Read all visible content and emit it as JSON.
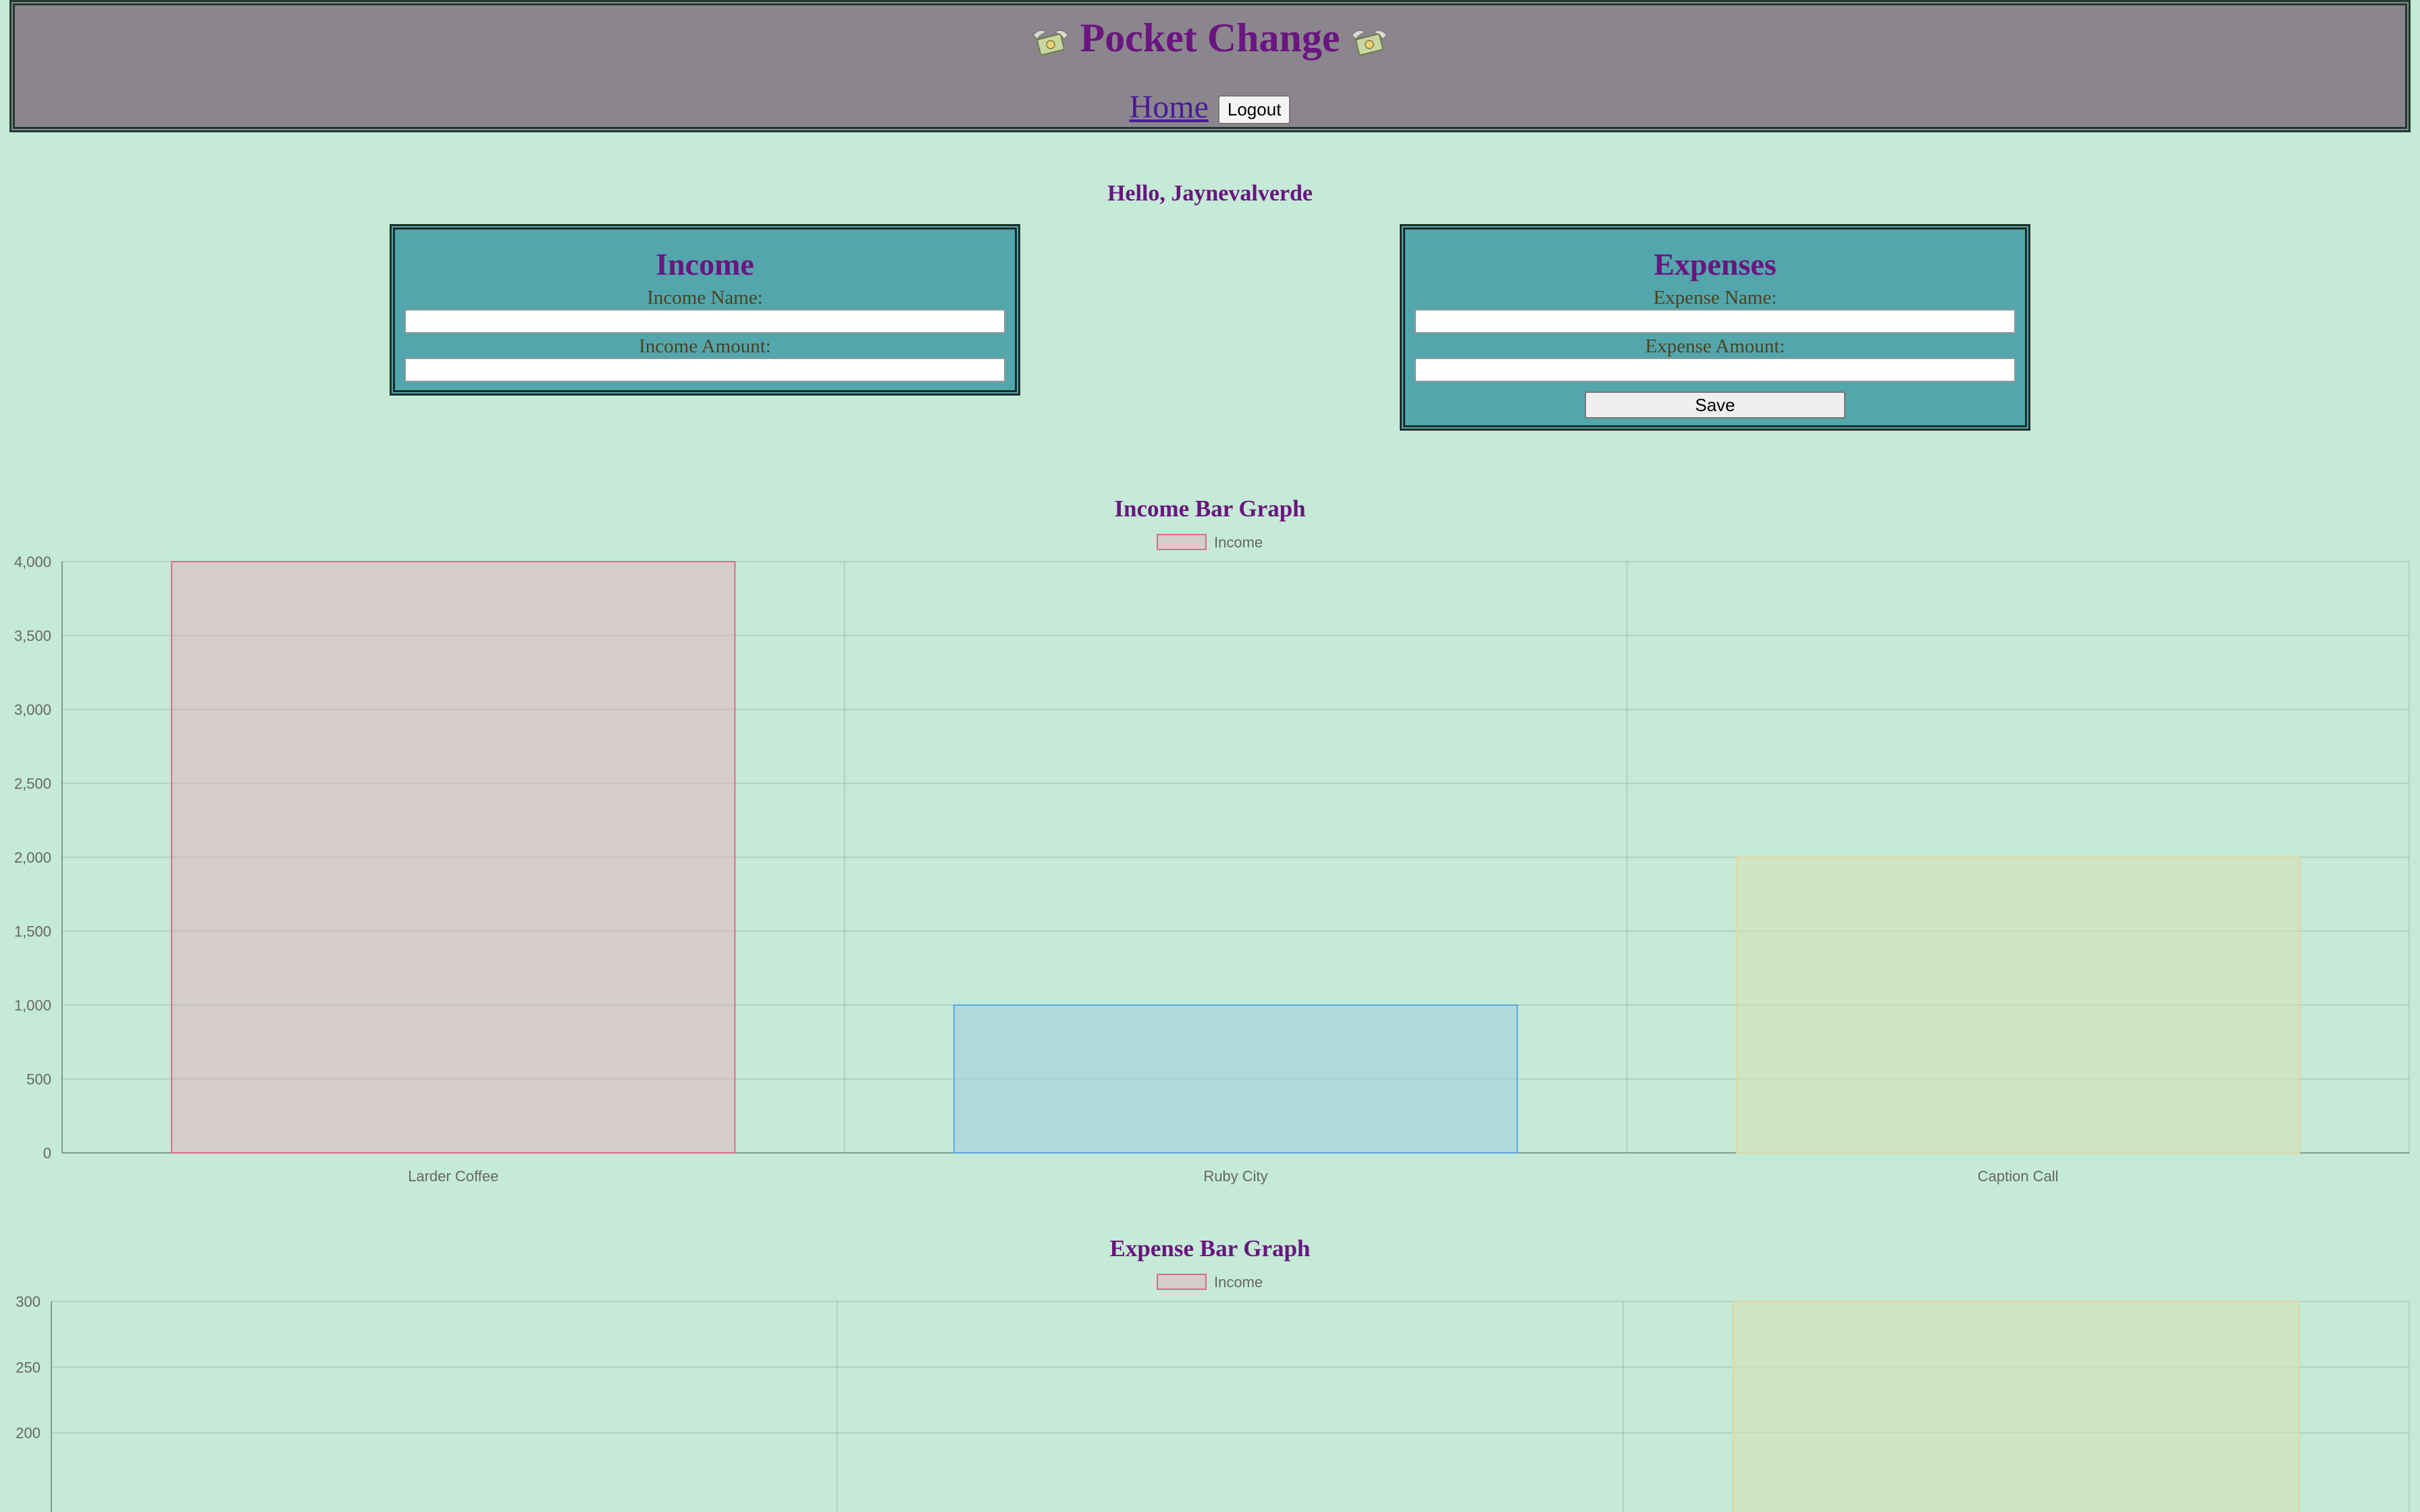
{
  "header": {
    "title": "Pocket Change",
    "left_icon": "money-with-wings-icon",
    "right_icon": "money-with-wings-icon"
  },
  "nav": {
    "home_label": "Home",
    "logout_label": "Logout"
  },
  "greeting": "Hello, Jaynevalverde",
  "income_panel": {
    "title": "Income",
    "name_label": "Income Name:",
    "name_value": "",
    "amount_label": "Income Amount:",
    "amount_value": ""
  },
  "expense_panel": {
    "title": "Expenses",
    "name_label": "Expense Name:",
    "name_value": "",
    "amount_label": "Expense Amount:",
    "amount_value": "",
    "save_label": "Save"
  },
  "colors": {
    "background": "#c5ead7",
    "header_bg": "#8b868e",
    "title_purple": "#6a1580",
    "panel_teal": "#54a6ad"
  },
  "chart_data": [
    {
      "type": "bar",
      "title": "Income Bar Graph",
      "legend": "top",
      "grid": true,
      "categories": [
        "Larder Coffee",
        "Ruby City",
        "Caption Call"
      ],
      "series": [
        {
          "name": "Income",
          "values": [
            4000,
            1000,
            2000
          ]
        }
      ],
      "bar_fills": [
        "rgba(230,170,190,0.45)",
        "rgba(150,200,230,0.45)",
        "rgba(225,225,170,0.45)"
      ],
      "bar_strokes": [
        "#e06a8a",
        "#5aa6dd",
        "#ddd7a6"
      ],
      "ylim": [
        0,
        4000
      ],
      "yticks": [
        "0",
        "500",
        "1,000",
        "1,500",
        "2,000",
        "2,500",
        "3,000",
        "3,500",
        "4,000"
      ]
    },
    {
      "type": "bar",
      "title": "Expense Bar Graph",
      "legend": "top",
      "grid": true,
      "categories": [
        "",
        "",
        ""
      ],
      "series": [
        {
          "name": "Income",
          "values": [
            0,
            0,
            300
          ]
        }
      ],
      "bar_fills": [
        "rgba(230,170,190,0.45)",
        "rgba(150,200,230,0.45)",
        "rgba(225,225,170,0.45)"
      ],
      "bar_strokes": [
        "#e06a8a",
        "#5aa6dd",
        "#ddd7a6"
      ],
      "ylim": [
        0,
        300
      ],
      "yticks": [
        "200",
        "250",
        "300"
      ]
    }
  ]
}
